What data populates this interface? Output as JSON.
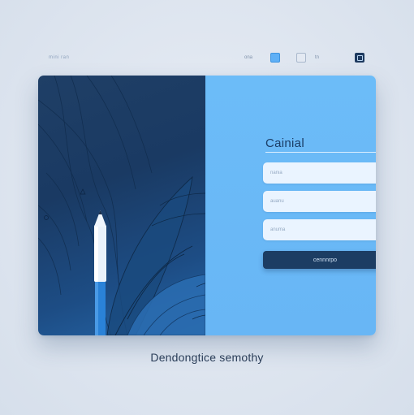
{
  "topbar": {
    "brand": "mini ran",
    "link_1": "ona",
    "link_2": "tn",
    "icons": [
      "square-icon",
      "frame-icon",
      "window-icon"
    ]
  },
  "form": {
    "title": "Cainial",
    "field_1_placeholder": "nania",
    "field_2_placeholder": "auanu",
    "field_3_placeholder": "anuma",
    "submit_label": "cennnrpo"
  },
  "caption": "Dendongtice semothy",
  "colors": {
    "art_panel": "#1f3f66",
    "form_panel": "#6cbcf8",
    "button": "#1c3d63",
    "title": "#1b3d66",
    "background": "#dde4ee"
  }
}
